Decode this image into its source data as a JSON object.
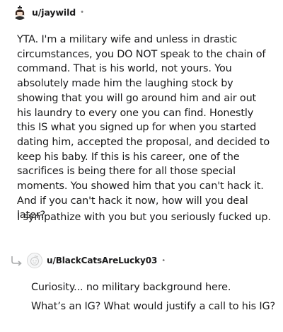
{
  "comments": [
    {
      "username": "u/jaywild",
      "separator": "•",
      "paragraphs": [
        "YTA. I'm a military wife and unless in drastic circumstances, you DO NOT speak to the chain of command. That is his world, not yours. You absolutely made him the laughing stock by showing that you will go around him and air out his laundry to every one you can find. Honestly this IS what you signed up for when you started dating him, accepted the proposal, and decided to keep his baby. If this is his career, one of the sacrifices is being there for all those special moments. You showed him that you can't hack it. And if you can't hack it now, how will you deal later?",
        "I sympathize with you but you seriously fucked up."
      ]
    },
    {
      "username": "u/BlackCatsAreLucky03",
      "separator": "•",
      "paragraphs": [
        "Curiosity... no military background here.",
        "What’s an IG? What would justify a call to his IG?"
      ]
    }
  ],
  "icons": {
    "reply": "reply-arrow-icon",
    "avatar_default": "snoo-avatar-icon"
  }
}
